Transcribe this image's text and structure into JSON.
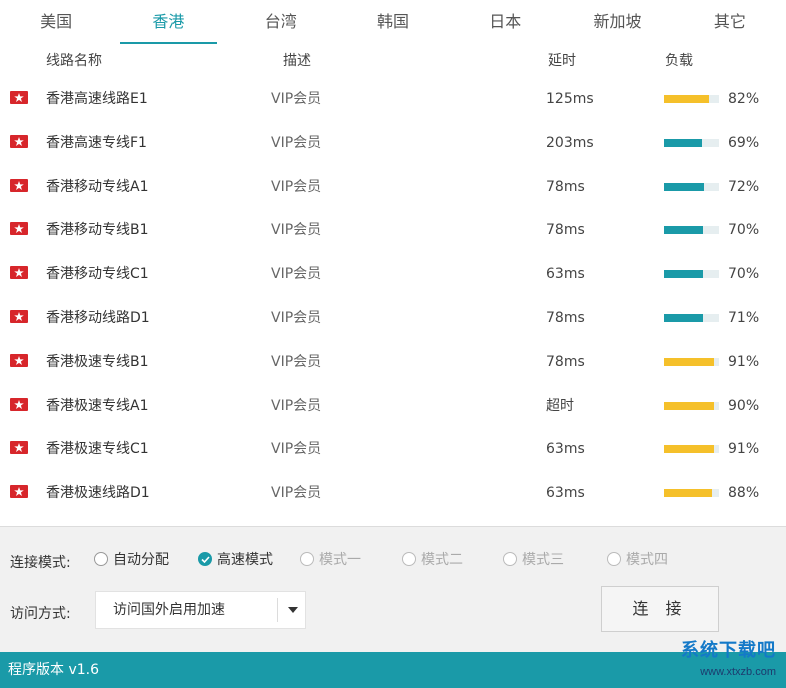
{
  "tabs": [
    "美国",
    "香港",
    "台湾",
    "韩国",
    "日本",
    "新加坡",
    "其它"
  ],
  "active_tab": 1,
  "columns": {
    "name": "线路名称",
    "desc": "描述",
    "latency": "延时",
    "load": "负载"
  },
  "colors": {
    "accent": "#1a9aa8",
    "load_high": "#f5c02a",
    "load_mid": "#1a9aa8",
    "flag_red": "#d7262b"
  },
  "rows": [
    {
      "flag": "hongkong-flag-icon",
      "name": "香港高速线路E1",
      "desc": "VIP会员",
      "latency": "125ms",
      "load": 82,
      "load_label": "82%"
    },
    {
      "flag": "hongkong-flag-icon",
      "name": "香港高速专线F1",
      "desc": "VIP会员",
      "latency": "203ms",
      "load": 69,
      "load_label": "69%"
    },
    {
      "flag": "hongkong-flag-icon",
      "name": "香港移动专线A1",
      "desc": "VIP会员",
      "latency": "78ms",
      "load": 72,
      "load_label": "72%"
    },
    {
      "flag": "hongkong-flag-icon",
      "name": "香港移动专线B1",
      "desc": "VIP会员",
      "latency": "78ms",
      "load": 70,
      "load_label": "70%"
    },
    {
      "flag": "hongkong-flag-icon",
      "name": "香港移动专线C1",
      "desc": "VIP会员",
      "latency": "63ms",
      "load": 70,
      "load_label": "70%"
    },
    {
      "flag": "hongkong-flag-icon",
      "name": "香港移动线路D1",
      "desc": "VIP会员",
      "latency": "78ms",
      "load": 71,
      "load_label": "71%"
    },
    {
      "flag": "hongkong-flag-icon",
      "name": "香港极速专线B1",
      "desc": "VIP会员",
      "latency": "78ms",
      "load": 91,
      "load_label": "91%"
    },
    {
      "flag": "hongkong-flag-icon",
      "name": "香港极速专线A1",
      "desc": "VIP会员",
      "latency": "超时",
      "load": 90,
      "load_label": "90%"
    },
    {
      "flag": "hongkong-flag-icon",
      "name": "香港极速专线C1",
      "desc": "VIP会员",
      "latency": "63ms",
      "load": 91,
      "load_label": "91%"
    },
    {
      "flag": "hongkong-flag-icon",
      "name": "香港极速线路D1",
      "desc": "VIP会员",
      "latency": "63ms",
      "load": 88,
      "load_label": "88%"
    }
  ],
  "connect_mode": {
    "label": "连接模式:",
    "options": [
      {
        "label": "自动分配",
        "checked": false,
        "disabled": false
      },
      {
        "label": "高速模式",
        "checked": true,
        "disabled": false
      },
      {
        "label": "模式一",
        "checked": false,
        "disabled": true
      },
      {
        "label": "模式二",
        "checked": false,
        "disabled": true
      },
      {
        "label": "模式三",
        "checked": false,
        "disabled": true
      },
      {
        "label": "模式四",
        "checked": false,
        "disabled": true
      }
    ]
  },
  "access_mode": {
    "label": "访问方式:",
    "value": "访问国外启用加速"
  },
  "connect_button": "连 接",
  "status": {
    "version": "程序版本 v1.6"
  },
  "watermark": {
    "title": "系统下载吧",
    "url": "www.xtxzb.com"
  }
}
